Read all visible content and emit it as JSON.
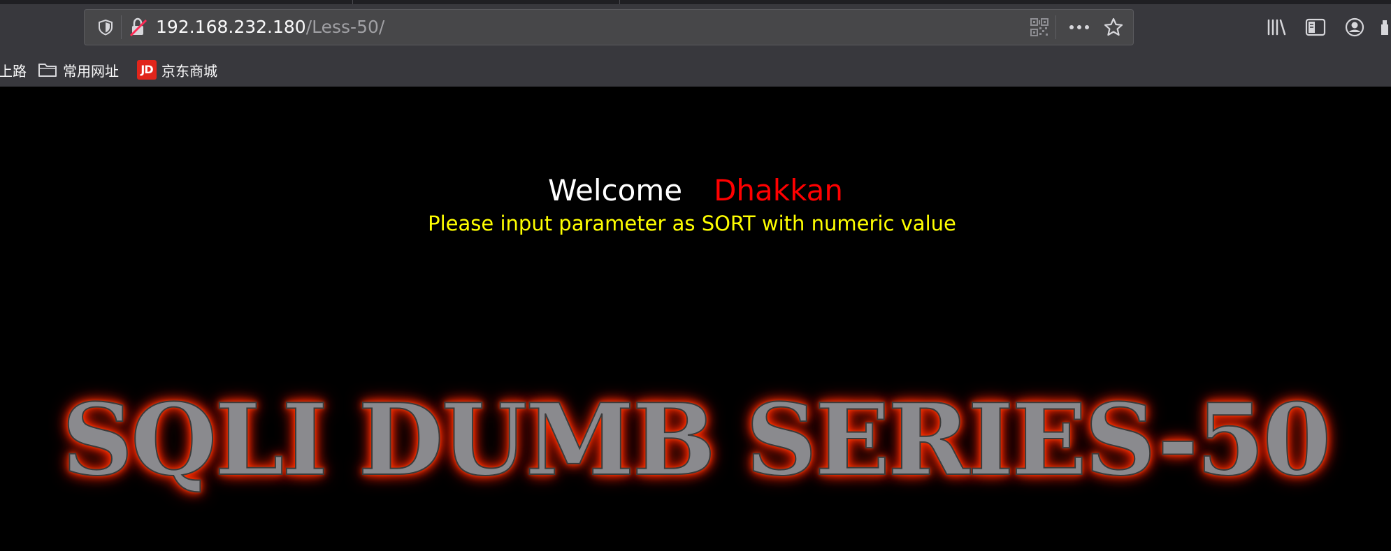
{
  "browser": {
    "url_host": "192.168.232.180",
    "url_path": "/Less-50/",
    "toolbar_icons": [
      "tracking-protection-shield-icon",
      "insecure-connection-icon",
      "qr-code-icon",
      "page-actions-more-icon",
      "bookmark-star-icon",
      "library-icon",
      "sidebar-toggle-icon",
      "account-icon"
    ],
    "bookmarks": [
      {
        "label": "上路",
        "icon": "none"
      },
      {
        "label": "常用网址",
        "icon": "folder-icon"
      },
      {
        "label": "京东商城",
        "icon": "jd-logo-icon",
        "badge": "JD"
      }
    ]
  },
  "page": {
    "welcome_label": "Welcome",
    "user_name": "Dhakkan",
    "instruction": "Please input parameter as SORT with numeric value",
    "banner_text": "SQLI DUMB SERIES-50"
  },
  "colors": {
    "page_background": "#000000",
    "welcome": "#ffffff",
    "user_name": "#ff0000",
    "instruction": "#ffff00",
    "banner_glow": "#ff3a00",
    "chrome": "#38383d"
  }
}
